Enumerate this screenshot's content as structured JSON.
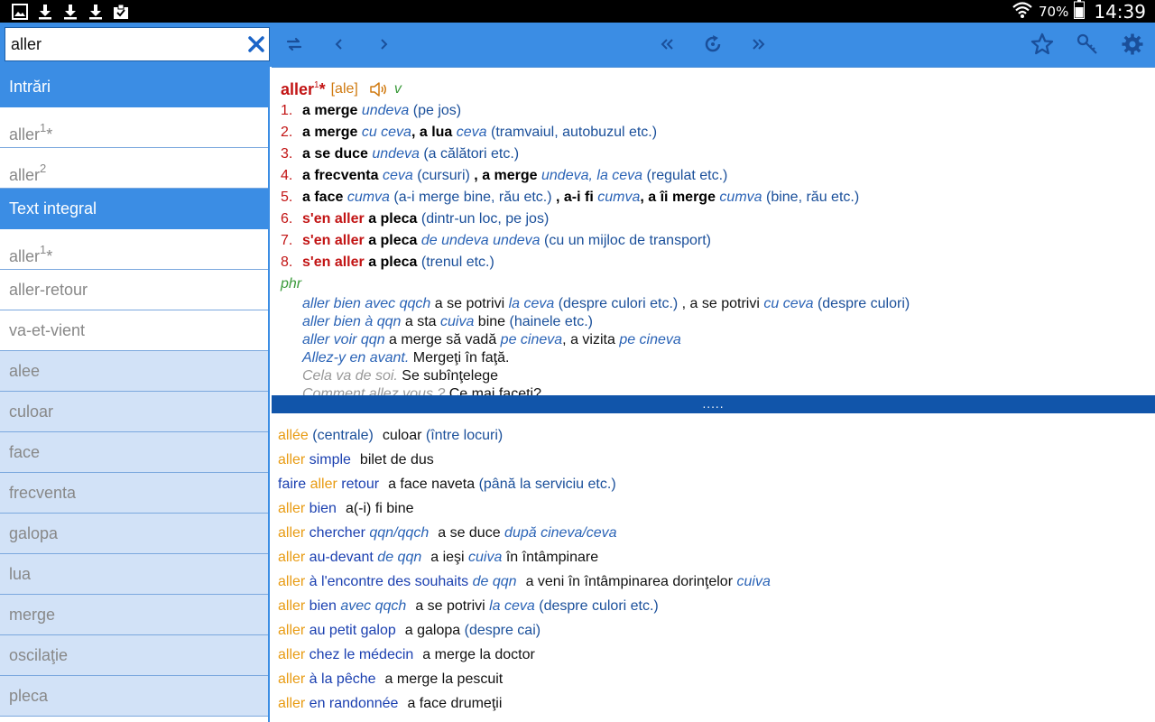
{
  "status_bar": {
    "battery": "70%",
    "time": "14:39"
  },
  "search": {
    "value": "aller"
  },
  "sidebar": {
    "section_entries": "Intrări",
    "entries": [
      {
        "text": "aller",
        "sup": "1",
        "suffix": "*"
      },
      {
        "text": "aller",
        "sup": "2",
        "suffix": ""
      }
    ],
    "section_fulltext": "Text integral",
    "fulltext_items": [
      {
        "text": "aller",
        "sup": "1",
        "suffix": "*",
        "style": "white"
      },
      {
        "text": "aller-retour",
        "sup": "",
        "suffix": "",
        "style": "white"
      },
      {
        "text": "va-et-vient",
        "sup": "",
        "suffix": "",
        "style": "white"
      },
      {
        "text": "alee",
        "sup": "",
        "suffix": "",
        "style": "blue"
      },
      {
        "text": "culoar",
        "sup": "",
        "suffix": "",
        "style": "blue"
      },
      {
        "text": "face",
        "sup": "",
        "suffix": "",
        "style": "blue"
      },
      {
        "text": "frecventa",
        "sup": "",
        "suffix": "",
        "style": "blue"
      },
      {
        "text": "galopa",
        "sup": "",
        "suffix": "",
        "style": "blue"
      },
      {
        "text": "lua",
        "sup": "",
        "suffix": "",
        "style": "blue"
      },
      {
        "text": "merge",
        "sup": "",
        "suffix": "",
        "style": "blue"
      },
      {
        "text": "oscilaţie",
        "sup": "",
        "suffix": "",
        "style": "blue"
      },
      {
        "text": "pleca",
        "sup": "",
        "suffix": "",
        "style": "blue"
      }
    ]
  },
  "article": {
    "headword": "aller",
    "headword_sup": "1",
    "headword_mark": "*",
    "pronunciation": "[ale]",
    "pos": "v",
    "senses": [
      {
        "num": "1.",
        "parts": [
          [
            "b",
            "a merge "
          ],
          [
            "it",
            "undeva "
          ],
          [
            "gl",
            "(pe jos)"
          ]
        ]
      },
      {
        "num": "2.",
        "parts": [
          [
            "b",
            "a merge "
          ],
          [
            "it",
            "cu ceva"
          ],
          [
            "b",
            ", a lua "
          ],
          [
            "it",
            "ceva "
          ],
          [
            "gl",
            "(tramvaiul, autobuzul etc.)"
          ]
        ]
      },
      {
        "num": "3.",
        "parts": [
          [
            "b",
            "a se duce "
          ],
          [
            "it",
            "undeva "
          ],
          [
            "gl",
            "(a călători etc.)"
          ]
        ]
      },
      {
        "num": "4.",
        "parts": [
          [
            "b",
            "a frecventa "
          ],
          [
            "it",
            "ceva "
          ],
          [
            "gl",
            "(cursuri) "
          ],
          [
            "b",
            ", a merge "
          ],
          [
            "it",
            "undeva, la ceva "
          ],
          [
            "gl",
            "(regulat etc.)"
          ]
        ]
      },
      {
        "num": "5.",
        "parts": [
          [
            "b",
            "a face "
          ],
          [
            "it",
            "cumva "
          ],
          [
            "gl",
            "(a-i merge bine, rău etc.) "
          ],
          [
            "b",
            ", a-i fi "
          ],
          [
            "it",
            "cumva"
          ],
          [
            "b",
            ", a îi merge "
          ],
          [
            "it",
            "cumva "
          ],
          [
            "gl",
            "(bine, rău etc.)"
          ]
        ]
      },
      {
        "num": "6.",
        "parts": [
          [
            "red",
            "s'en aller "
          ],
          [
            "b",
            "a pleca "
          ],
          [
            "gl",
            "(dintr-un loc, pe jos)"
          ]
        ]
      },
      {
        "num": "7.",
        "parts": [
          [
            "red",
            "s'en aller "
          ],
          [
            "b",
            "a pleca "
          ],
          [
            "it",
            "de undeva undeva "
          ],
          [
            "gl",
            "(cu un mijloc de transport)"
          ]
        ]
      },
      {
        "num": "8.",
        "parts": [
          [
            "red",
            "s'en aller "
          ],
          [
            "b",
            "a pleca "
          ],
          [
            "gl",
            "(trenul etc.)"
          ]
        ]
      }
    ],
    "phr_label": "phr",
    "phrases": [
      [
        [
          "it",
          "aller bien avec qqch "
        ],
        [
          "blk",
          "a se potrivi "
        ],
        [
          "it",
          "la ceva "
        ],
        [
          "gl",
          "(despre culori etc.) "
        ],
        [
          "blk",
          ", a se potrivi "
        ],
        [
          "it",
          "cu ceva "
        ],
        [
          "gl",
          "(despre culori)"
        ]
      ],
      [
        [
          "it",
          "aller bien à qqn "
        ],
        [
          "blk",
          "a sta "
        ],
        [
          "it",
          "cuiva "
        ],
        [
          "blk",
          "bine "
        ],
        [
          "gl",
          "(hainele etc.)"
        ]
      ],
      [
        [
          "it",
          "aller voir qqn "
        ],
        [
          "blk",
          "a merge să vadă "
        ],
        [
          "it",
          "pe cineva"
        ],
        [
          "blk",
          ", a vizita "
        ],
        [
          "it",
          "pe cineva"
        ]
      ],
      [
        [
          "it",
          "Allez-y en avant. "
        ],
        [
          "blk",
          "Mergeţi în faţă."
        ]
      ],
      [
        [
          "grey",
          "Cela va de soi. "
        ],
        [
          "blk",
          "Se subînţelege"
        ]
      ],
      [
        [
          "grey",
          "Comment allez vous ? "
        ],
        [
          "blk",
          "Ce mai faceţi?"
        ]
      ]
    ]
  },
  "splitter": {
    "label": "....."
  },
  "fulltext": [
    [
      [
        "kw",
        "allée"
      ],
      [
        "gl",
        " (centrale)"
      ],
      [
        "tr",
        "culoar "
      ],
      [
        "gl",
        "(între locuri)"
      ]
    ],
    [
      [
        "kw",
        "aller"
      ],
      [
        "fr",
        " simple"
      ],
      [
        "tr",
        "bilet de dus"
      ]
    ],
    [
      [
        "fr",
        "faire "
      ],
      [
        "kw",
        "aller"
      ],
      [
        "fr",
        " retour"
      ],
      [
        "tr",
        "a face naveta "
      ],
      [
        "gl",
        "(până la serviciu etc.)"
      ]
    ],
    [
      [
        "kw",
        "aller"
      ],
      [
        "fr",
        " bien"
      ],
      [
        "tr",
        "a(-i) fi bine"
      ]
    ],
    [
      [
        "kw",
        "aller"
      ],
      [
        "fr",
        " chercher "
      ],
      [
        "fri",
        "qqn/qqch"
      ],
      [
        "tr",
        "a se duce "
      ],
      [
        "it",
        "după cineva/ceva"
      ]
    ],
    [
      [
        "kw",
        "aller"
      ],
      [
        "fr",
        " au-devant "
      ],
      [
        "fri",
        "de qqn"
      ],
      [
        "tr",
        "a ieşi "
      ],
      [
        "it",
        "cuiva "
      ],
      [
        "tr0",
        "în întâmpinare"
      ]
    ],
    [
      [
        "kw",
        "aller"
      ],
      [
        "fr",
        " à l'encontre des souhaits "
      ],
      [
        "fri",
        "de qqn"
      ],
      [
        "tr",
        "a veni în întâmpinarea dorinţelor "
      ],
      [
        "it",
        "cuiva"
      ]
    ],
    [
      [
        "kw",
        "aller"
      ],
      [
        "fr",
        " bien "
      ],
      [
        "fri",
        "avec qqch"
      ],
      [
        "tr",
        "a se potrivi "
      ],
      [
        "it",
        "la ceva "
      ],
      [
        "gl",
        "(despre culori etc.)"
      ]
    ],
    [
      [
        "kw",
        "aller"
      ],
      [
        "fr",
        " au petit galop"
      ],
      [
        "tr",
        "a galopa "
      ],
      [
        "gl",
        "(despre cai)"
      ]
    ],
    [
      [
        "kw",
        "aller"
      ],
      [
        "fr",
        " chez le médecin"
      ],
      [
        "tr",
        "a merge la doctor"
      ]
    ],
    [
      [
        "kw",
        "aller"
      ],
      [
        "fr",
        " à la pêche"
      ],
      [
        "tr",
        "a merge la pescuit"
      ]
    ],
    [
      [
        "kw",
        "aller"
      ],
      [
        "fr",
        " en randonnée"
      ],
      [
        "tr",
        "a face drumeţii"
      ]
    ]
  ],
  "icons": {
    "status_left": [
      "gallery-icon",
      "download-icon",
      "download-icon",
      "download-icon",
      "clipboard-check-icon"
    ],
    "toolbar": [
      "sync-icon",
      "prev-icon",
      "next-icon",
      "history-back-icon",
      "refresh-icon",
      "history-forward-icon",
      "star-icon",
      "key-icon",
      "settings-gear-icon"
    ],
    "accent": "#3b8de4",
    "splitter": "#1155aa",
    "headword": "#c21414",
    "keyword": "#e89b12"
  }
}
